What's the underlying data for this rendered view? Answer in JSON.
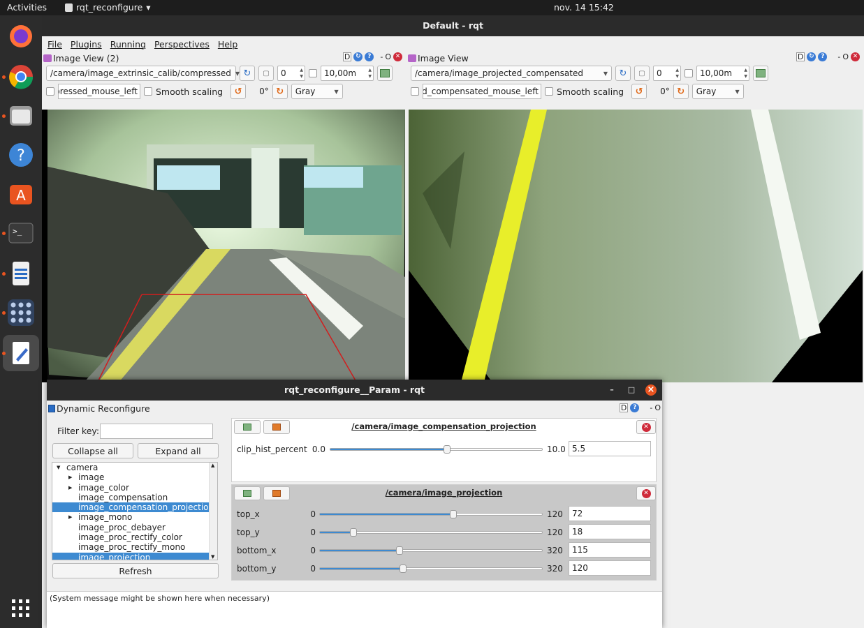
{
  "topbar": {
    "activities": "Activities",
    "app_name": "rqt_reconfigure",
    "app_arrow": "▾",
    "clock": "nov. 14  15:42"
  },
  "window": {
    "title": "Default - rqt"
  },
  "menu": [
    "File",
    "Plugins",
    "Running",
    "Perspectives",
    "Help"
  ],
  "dock_icons": [
    "firefox-icon",
    "chrome-icon",
    "files-icon",
    "help-icon",
    "software-center-icon",
    "terminal-icon",
    "writer-icon",
    "numbers-icon",
    "text-editor-icon"
  ],
  "left_view": {
    "title": "Image View (2)",
    "topic": "/camera/image_extrinsic_calib/compressed",
    "spin_value": "0",
    "range_value": "10,00m",
    "mouse_topic": "pressed_mouse_left",
    "smooth_label": "Smooth scaling",
    "rotation": "0°",
    "color_mode": "Gray"
  },
  "right_view": {
    "title": "Image View",
    "topic": "/camera/image_projected_compensated",
    "spin_value": "0",
    "range_value": "10,00m",
    "mouse_topic": "ed_compensated_mouse_left",
    "smooth_label": "Smooth scaling",
    "rotation": "0°",
    "color_mode": "Gray"
  },
  "header_btns": {
    "d": "D",
    "help": "?",
    "dash": "-",
    "o": "O"
  },
  "dialog": {
    "title": "rqt_reconfigure__Param - rqt",
    "plugin_title": "Dynamic Reconfigure",
    "filter_label": "Filter key:",
    "filter_value": "",
    "collapse_all": "Collapse all",
    "expand_all": "Expand all",
    "refresh": "Refresh",
    "tree": [
      {
        "label": "camera",
        "level": 0,
        "arrow": "expanded",
        "selected": false
      },
      {
        "label": "image",
        "level": 1,
        "arrow": "collapsed",
        "selected": false
      },
      {
        "label": "image_color",
        "level": 1,
        "arrow": "collapsed",
        "selected": false
      },
      {
        "label": "image_compensation",
        "level": 1,
        "arrow": "none",
        "selected": false
      },
      {
        "label": "image_compensation_projection",
        "level": 1,
        "arrow": "none",
        "selected": true
      },
      {
        "label": "image_mono",
        "level": 1,
        "arrow": "collapsed",
        "selected": false
      },
      {
        "label": "image_proc_debayer",
        "level": 1,
        "arrow": "none",
        "selected": false
      },
      {
        "label": "image_proc_rectify_color",
        "level": 1,
        "arrow": "none",
        "selected": false
      },
      {
        "label": "image_proc_rectify_mono",
        "level": 1,
        "arrow": "none",
        "selected": false
      },
      {
        "label": "image_projection",
        "level": 1,
        "arrow": "none",
        "selected": true
      }
    ],
    "section1": {
      "name": "/camera/image_compensation_projection",
      "params": [
        {
          "name": "clip_hist_percent",
          "min": "0.0",
          "max": "10.0",
          "value": "5.5",
          "fraction": 0.55
        }
      ]
    },
    "section2": {
      "name": "/camera/image_projection",
      "params": [
        {
          "name": "top_x",
          "min": "0",
          "max": "120",
          "value": "72",
          "fraction": 0.6
        },
        {
          "name": "top_y",
          "min": "0",
          "max": "120",
          "value": "18",
          "fraction": 0.15
        },
        {
          "name": "bottom_x",
          "min": "0",
          "max": "320",
          "value": "115",
          "fraction": 0.36
        },
        {
          "name": "bottom_y",
          "min": "0",
          "max": "320",
          "value": "120",
          "fraction": 0.375
        }
      ]
    },
    "system_message": "(System message might be shown here when necessary)",
    "window_buttons": {
      "minimize": "–",
      "maximize": "□",
      "close": "×"
    }
  },
  "colors": {
    "selection": "#3d8ad1",
    "accent": "#e95420",
    "close_red": "#cf2a3a"
  }
}
